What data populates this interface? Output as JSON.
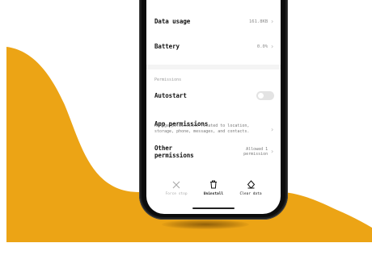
{
  "colors": {
    "accent": "#ECA415",
    "toggle_off": "#e3e3e3",
    "disabled_text": "#aaaaaa"
  },
  "app_info": {
    "rows": [
      {
        "label": "Data usage",
        "value": "161.8KB"
      },
      {
        "label": "Battery",
        "value": "0.0%"
      }
    ],
    "section_title": "Permissions",
    "autostart": {
      "label": "Autostart",
      "enabled": false
    },
    "app_permissions": {
      "label": "App permissions",
      "description": "Manage permissions related to location, storage, phone, messages, and contacts."
    },
    "other_permissions": {
      "label_line1": "Other",
      "label_line2": "permissions",
      "value_line1": "Allowed 1",
      "value_line2": "permission"
    },
    "actions": [
      {
        "icon": "close-icon",
        "label": "Force stop",
        "enabled": false
      },
      {
        "icon": "trash-icon",
        "label": "Uninstall",
        "enabled": true
      },
      {
        "icon": "eraser-icon",
        "label": "Clear data",
        "enabled": true
      }
    ]
  }
}
